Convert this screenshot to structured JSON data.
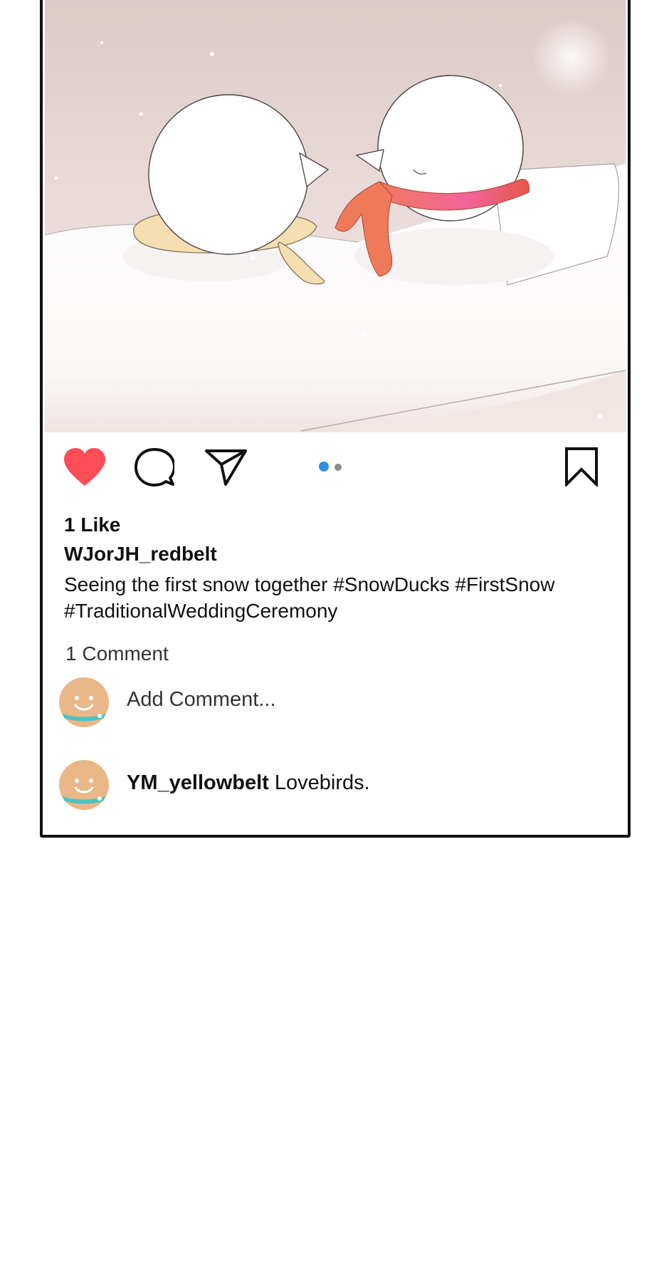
{
  "post": {
    "likes_text": "1 Like",
    "username": "WJorJH_redbelt",
    "caption": "Seeing the first snow together #SnowDucks #FirstSnow #TraditionalWeddingCeremony",
    "comments_count_text": "1 Comment",
    "add_comment_placeholder": "Add Comment...",
    "comments": [
      {
        "author": "YM_yellowbelt",
        "text": "Lovebirds."
      }
    ]
  },
  "icons": {
    "like": "heart-filled-icon",
    "comment": "speech-bubble-icon",
    "share": "paper-plane-icon",
    "bookmark": "bookmark-icon"
  },
  "carousel": {
    "count": 2,
    "active_index": 0
  },
  "colors": {
    "like": "#ff4d57",
    "active_dot": "#2f8de4",
    "inactive_dot": "#8a8a8a",
    "frame_border": "#111111"
  }
}
